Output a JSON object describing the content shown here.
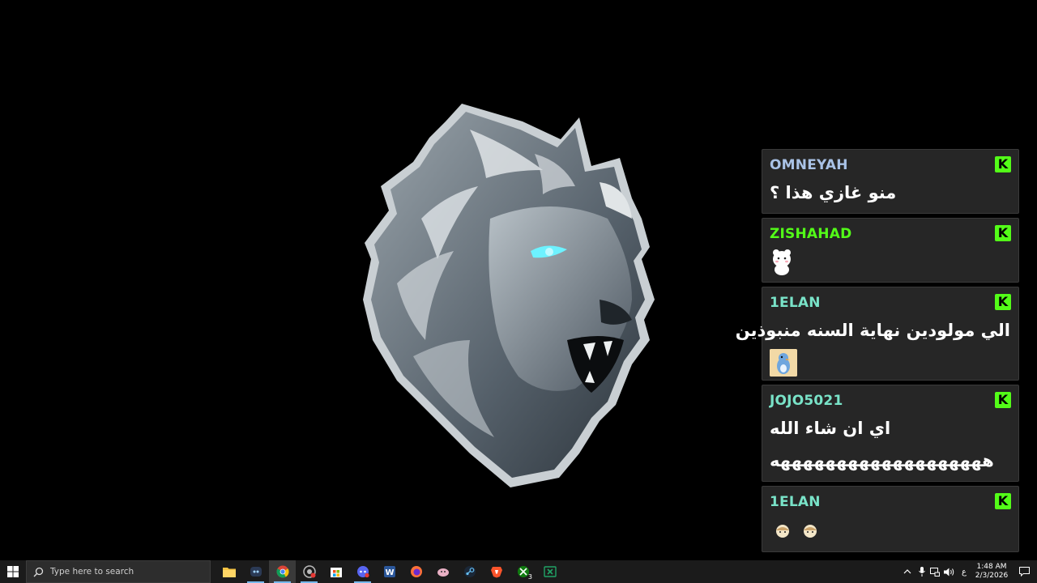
{
  "chat": {
    "messages": [
      {
        "user": "OMNEYAH",
        "user_color": "#a9c2e6",
        "badge": "K",
        "lines": [
          "منو غازي هذا ؟"
        ],
        "emotes": []
      },
      {
        "user": "ZISHAHAD",
        "user_color": "#53fc18",
        "badge": "K",
        "lines": [],
        "emotes": [
          "white-bear-emote"
        ]
      },
      {
        "user": "1ELAN",
        "user_color": "#79e3c8",
        "badge": "K",
        "lines": [
          "الي مولودين نهاية السنه منبوذين"
        ],
        "emotes": [
          "blue-bird-emote"
        ]
      },
      {
        "user": "JOJO5021",
        "user_color": "#79e3c8",
        "badge": "K",
        "lines": [
          "اي ان شاء الله",
          "هههههههههههههههههههه"
        ],
        "emotes": []
      },
      {
        "user": "1ELAN",
        "user_color": "#79e3c8",
        "badge": "K",
        "lines": [],
        "emotes": [
          "face-emote",
          "face-emote"
        ]
      }
    ]
  },
  "taskbar": {
    "search_placeholder": "Type here to search",
    "apps": [
      {
        "name": "file-explorer-icon"
      },
      {
        "name": "discord-like-icon"
      },
      {
        "name": "chrome-icon",
        "active": true
      },
      {
        "name": "chrome-alt-icon"
      },
      {
        "name": "store-icon"
      },
      {
        "name": "messenger-icon"
      },
      {
        "name": "word-icon"
      },
      {
        "name": "firefox-icon"
      },
      {
        "name": "app-icon"
      },
      {
        "name": "steam-icon"
      },
      {
        "name": "brave-icon"
      },
      {
        "name": "xbox-icon",
        "badge": "3"
      },
      {
        "name": "excel-icon"
      }
    ],
    "tray": {
      "lang": "ع",
      "time": "1:48 AM",
      "date": "2/3/2026"
    }
  },
  "colors": {
    "kick_green": "#53fc18",
    "taskbar_bg": "#1b1b1b",
    "chat_bg": "#262626"
  }
}
